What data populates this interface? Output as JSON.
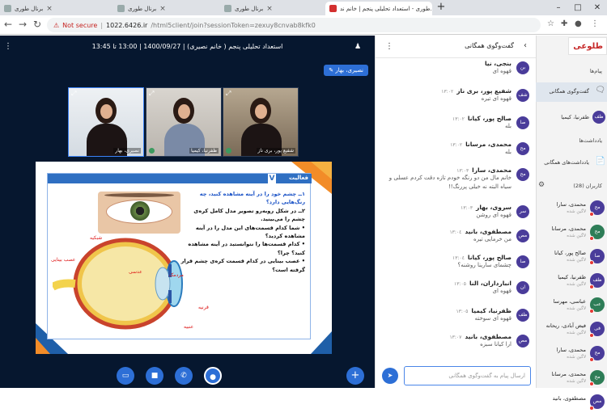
{
  "browser": {
    "tabs": [
      {
        "title": "برنال طوری",
        "active": false
      },
      {
        "title": "برنال طوری",
        "active": false
      },
      {
        "title": "برنال طوری",
        "active": false
      },
      {
        "title": "طوری - استعداد تحلیلی پنجم | خانم ند...",
        "active": true
      }
    ],
    "new_tab": "+",
    "security": "Not secure",
    "host": "1022.6426.ir",
    "path": "/html5client/join?sessionToken=zexuy8cnvab8kfk0"
  },
  "conference": {
    "title": "استعداد تحلیلی پنجم ( خانم نصیری) | 1400/09/27 | 13:00 تا 13:45",
    "presenter": "نصیری، بهار",
    "webcams": [
      {
        "label": "شفیع پور، بری ناز"
      },
      {
        "label": "ظفرنیا، کیمیا"
      },
      {
        "label": "نصیری، بهار"
      }
    ]
  },
  "slide": {
    "activity_label": "فعالیت",
    "activity_icon": "V",
    "questions": [
      {
        "text": "١ــ چشم خود را در آینه مشاهده کنید، چه رنگ‌هایی دارد؟",
        "style": "p"
      },
      {
        "text": "٢ــ در شکل روبه‌رو تصویر مدل کامل کره‌ی چشم را می‌بینید.",
        "style": "n"
      },
      {
        "text": "• شما کدام قسمت‌های این مدل را در آینه مشاهده کردید؟",
        "style": "n"
      },
      {
        "text": "• کدام قسمت‌ها را نتوانستید در آینه مشاهده کنید؟ چرا؟",
        "style": "n"
      },
      {
        "text": "• عصب بینایی در کدام قسمت کره‌ی چشم قرار گرفته است؟",
        "style": "n"
      }
    ],
    "diagram_labels": {
      "retina": "شبکیه",
      "optic_nerve": "عصب بینایی",
      "pupil": "مردمک",
      "lens": "عدسی",
      "cornea": "قرنیه",
      "iris": "عنبیه"
    }
  },
  "chat": {
    "title": "گفت‌وگوی همگانی",
    "placeholder": "ارسال پیام به گفت‌وگوی همگانی",
    "messages": [
      {
        "avatar": "بن",
        "name": "بنجی، نیا",
        "time": "",
        "text": "قهوه ای"
      },
      {
        "avatar": "شف",
        "name": "شفیع پور، بری ناز",
        "time": "١٣:٠٢",
        "text": "قهوه ای تیره"
      },
      {
        "avatar": "صا",
        "name": "صالح پور، کیانا",
        "time": "١٣:٠٢",
        "text": "بله"
      },
      {
        "avatar": "مح",
        "name": "محمدی، مرسانا",
        "time": "١٣:٠٢",
        "text": "بله"
      },
      {
        "avatar": "مح",
        "name": "محمدی، سارا",
        "time": "١٣:٠٣",
        "text": "خانم مال من دو رنگه خودم تازه دقت کردم عسلی و سیاه البته نه خیلی پررنگ!!"
      },
      {
        "avatar": "سر",
        "name": "سروی، بهار",
        "time": "١٣:٠٣",
        "text": "قهوه ای روشن"
      },
      {
        "avatar": "مص",
        "name": "مصطفوی، بانید",
        "time": "١٣:٠٤",
        "text": "من خرمایی تیره"
      },
      {
        "avatar": "صا",
        "name": "صالح پور، کیانا",
        "time": "١٣:٠٤",
        "text": "چشمای سارینا روشنه؟"
      },
      {
        "avatar": "ان",
        "name": "انبارداران، النا",
        "time": "١٣:٠٥",
        "text": "قهوه ای"
      },
      {
        "avatar": "ظف",
        "name": "ظفرنیا، کیمیا",
        "time": "١٣:٠٥",
        "text": "قهوه ای سوخته"
      },
      {
        "avatar": "مص",
        "name": "مصطفوی، بانید",
        "time": "١٣:٠٧",
        "text": "ارا کیانا سبزه"
      }
    ]
  },
  "sidebar": {
    "logo": "طلوعی",
    "messages_label": "پیام‌ها",
    "public_chat": "گفت‌وگوی همگانی",
    "private_chat": {
      "avatar": "ظف",
      "name": "ظفرنیا، کیمیا"
    },
    "notes_label": "یادداشت‌ها",
    "shared_notes": "یادداشت‌های همگانی",
    "users_label": "کاربران (28)",
    "users": [
      {
        "avatar": "مح",
        "name": "محمدی، سارا",
        "status": "لاگین شده"
      },
      {
        "avatar": "مح",
        "name": "محمدی، مرسانا",
        "status": "لاگین شده"
      },
      {
        "avatar": "صا",
        "name": "صالح پور، کیانا",
        "status": "لاگین شده"
      },
      {
        "avatar": "ظف",
        "name": "ظفرنیا، کیمیا",
        "status": "لاگین شده"
      },
      {
        "avatar": "عب",
        "name": "عباسی، مهرسا",
        "status": "لاگین شده"
      },
      {
        "avatar": "فی",
        "name": "فیض آبادی، ریحانه",
        "status": "لاگین شده"
      },
      {
        "avatar": "مح",
        "name": "محمدی، سارا",
        "status": "لاگین شده"
      },
      {
        "avatar": "مح",
        "name": "محمدی، مرسانا",
        "status": "لاگین شده"
      },
      {
        "avatar": "مص",
        "name": "مصطفوی، بانید",
        "status": ""
      }
    ]
  },
  "colors": {
    "primary": "#2d6fd6",
    "conference_bg": "#06172f",
    "avatar": "#4a3c9a"
  }
}
